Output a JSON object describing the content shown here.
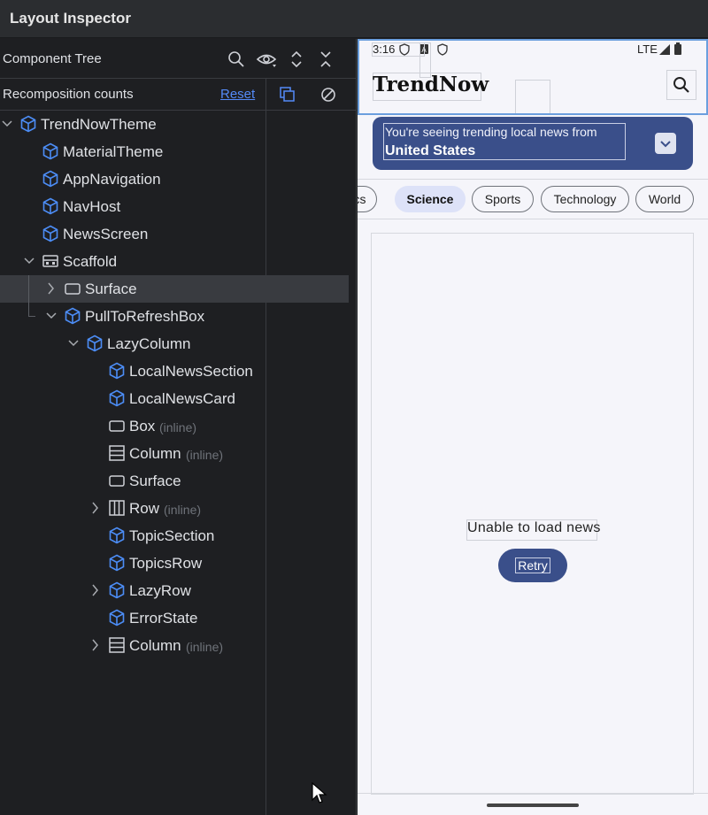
{
  "window": {
    "title": "Layout Inspector"
  },
  "component_tree": {
    "header_label": "Component Tree",
    "toolbar_icons": [
      "search-icon",
      "eye-icon",
      "expand-all-icon",
      "collapse-all-icon"
    ],
    "recomposition": {
      "label": "Recomposition counts",
      "reset_label": "Reset",
      "icons": [
        "copy-icon",
        "disable-icon"
      ]
    },
    "nodes": [
      {
        "label": "TrendNowTheme",
        "suffix": "",
        "icon": "compose-cube-icon",
        "expand": "expanded"
      },
      {
        "label": "MaterialTheme",
        "suffix": "",
        "icon": "compose-cube-icon",
        "expand": "none"
      },
      {
        "label": "AppNavigation",
        "suffix": "",
        "icon": "compose-cube-icon",
        "expand": "none"
      },
      {
        "label": "NavHost",
        "suffix": "",
        "icon": "compose-cube-icon",
        "expand": "none"
      },
      {
        "label": "NewsScreen",
        "suffix": "",
        "icon": "compose-cube-icon",
        "expand": "none"
      },
      {
        "label": "Scaffold",
        "suffix": "",
        "icon": "scaffold-icon",
        "expand": "expanded"
      },
      {
        "label": "Surface",
        "suffix": "",
        "icon": "surface-icon",
        "expand": "collapsed",
        "selected": true
      },
      {
        "label": "PullToRefreshBox",
        "suffix": "",
        "icon": "compose-cube-icon",
        "expand": "expanded"
      },
      {
        "label": "LazyColumn",
        "suffix": "",
        "icon": "compose-cube-icon",
        "expand": "expanded"
      },
      {
        "label": "LocalNewsSection",
        "suffix": "",
        "icon": "compose-cube-icon",
        "expand": "none"
      },
      {
        "label": "LocalNewsCard",
        "suffix": "",
        "icon": "compose-cube-icon",
        "expand": "none"
      },
      {
        "label": "Box",
        "suffix": "(inline)",
        "icon": "box-icon",
        "expand": "none"
      },
      {
        "label": "Column",
        "suffix": "(inline)",
        "icon": "column-icon",
        "expand": "none"
      },
      {
        "label": "Surface",
        "suffix": "",
        "icon": "surface-icon",
        "expand": "none"
      },
      {
        "label": "Row",
        "suffix": "(inline)",
        "icon": "row-icon",
        "expand": "collapsed"
      },
      {
        "label": "TopicSection",
        "suffix": "",
        "icon": "compose-cube-icon",
        "expand": "none"
      },
      {
        "label": "TopicsRow",
        "suffix": "",
        "icon": "compose-cube-icon",
        "expand": "none"
      },
      {
        "label": "LazyRow",
        "suffix": "",
        "icon": "compose-cube-icon",
        "expand": "collapsed"
      },
      {
        "label": "ErrorState",
        "suffix": "",
        "icon": "compose-cube-icon",
        "expand": "none"
      },
      {
        "label": "Column",
        "suffix": "(inline)",
        "icon": "column-icon",
        "expand": "collapsed"
      }
    ]
  },
  "device": {
    "status_bar": {
      "time": "3:16",
      "network": "LTE"
    },
    "app_title": "TrendNow",
    "banner": {
      "line1": "You're seeing trending local news from",
      "line2": "United States"
    },
    "chips": [
      {
        "label": "ics",
        "active": false
      },
      {
        "label": "Science",
        "active": true
      },
      {
        "label": "Sports",
        "active": false
      },
      {
        "label": "Technology",
        "active": false
      },
      {
        "label": "World",
        "active": false
      }
    ],
    "error_message": "Unable to load news",
    "retry_label": "Retry"
  },
  "colors": {
    "accent": "#548af7",
    "compose_icon": "#4c8df6",
    "banner": "#3a4f8a",
    "chip_active": "#dde2f8",
    "selection_outline": "#6b9fde"
  }
}
